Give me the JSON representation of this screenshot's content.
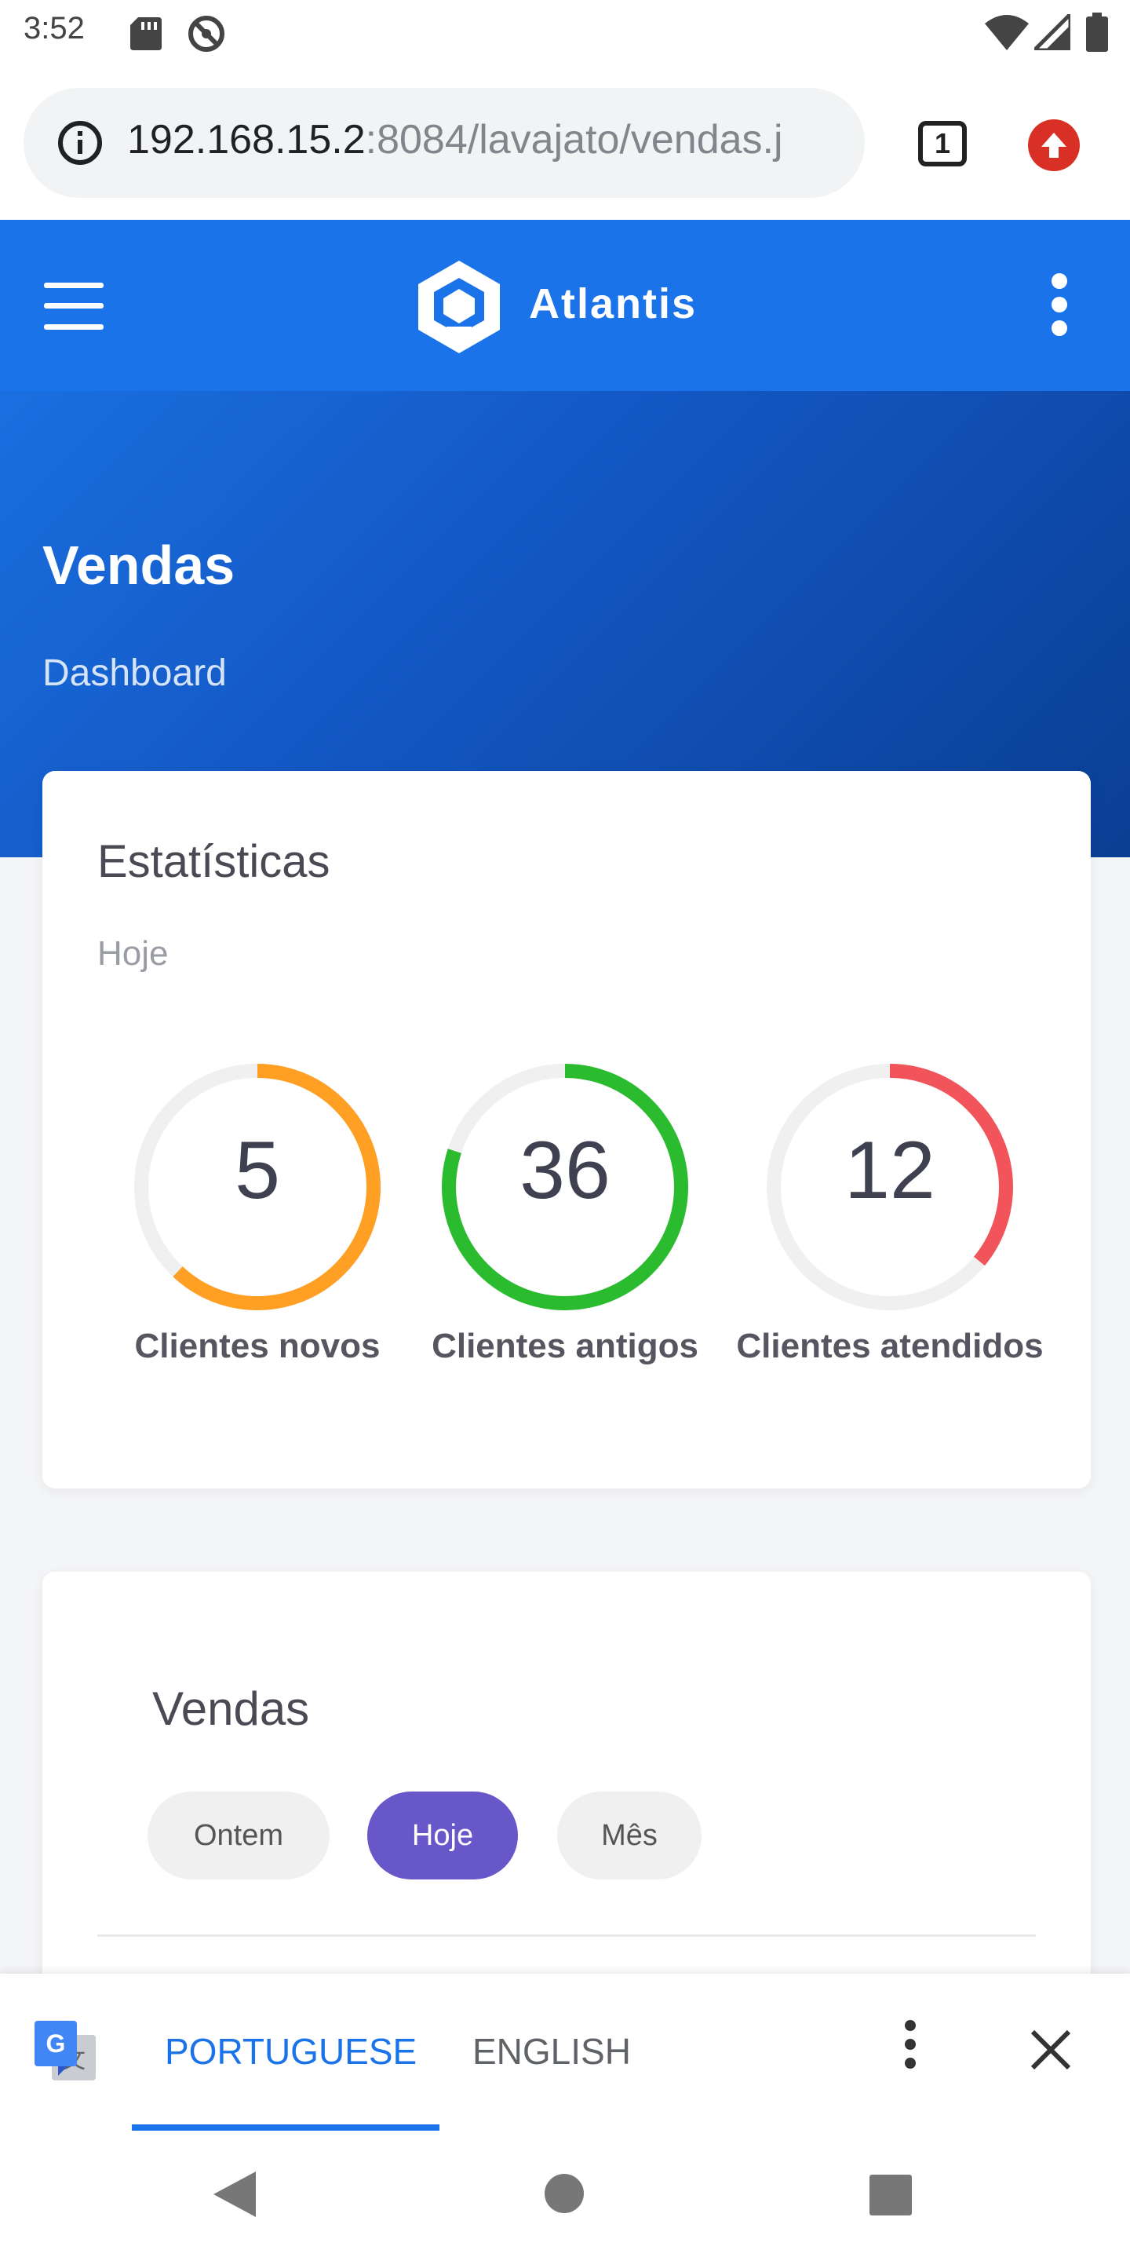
{
  "status_bar": {
    "time": "3:52",
    "icons": [
      "sd-card-icon",
      "do-not-disturb-icon",
      "wifi-icon",
      "cell-signal-icon",
      "battery-icon"
    ]
  },
  "browser": {
    "url_host": "192.168.15.2",
    "url_path": ":8084/lavajato/vendas.j",
    "tab_count": "1",
    "icons": [
      "info-icon",
      "tab-switcher-icon",
      "update-icon"
    ]
  },
  "header": {
    "brand": "Atlantis",
    "icons": [
      "hamburger-menu-icon",
      "atlantis-logo-icon",
      "kebab-menu-icon"
    ],
    "colors": {
      "header_bg": "#1a73e8"
    }
  },
  "hero": {
    "title": "Vendas",
    "subtitle": "Dashboard"
  },
  "stats": {
    "title": "Estatísticas",
    "subtitle": "Hoje",
    "gauges": [
      {
        "value": "5",
        "label": "Clientes novos",
        "fraction": 0.62,
        "color": "#ff9f24"
      },
      {
        "value": "36",
        "label": "Clientes antigos",
        "fraction": 0.8,
        "color": "#2bbb2e"
      },
      {
        "value": "12",
        "label": "Clientes atendidos",
        "fraction": 0.36,
        "color": "#f2545b"
      }
    ],
    "track_color": "#f0f0f0"
  },
  "sales": {
    "title": "Vendas",
    "filters": [
      {
        "label": "Ontem",
        "active": false
      },
      {
        "label": "Hoje",
        "active": true
      },
      {
        "label": "Mês",
        "active": false
      }
    ],
    "active_color": "#6857c9"
  },
  "translate_bar": {
    "languages": [
      "PORTUGUESE",
      "ENGLISH"
    ],
    "selected": "PORTUGUESE",
    "icons": [
      "google-translate-icon",
      "more-vert-icon",
      "close-icon"
    ]
  },
  "nav_bar": {
    "icons": [
      "back-icon",
      "home-icon",
      "recent-apps-icon"
    ]
  }
}
